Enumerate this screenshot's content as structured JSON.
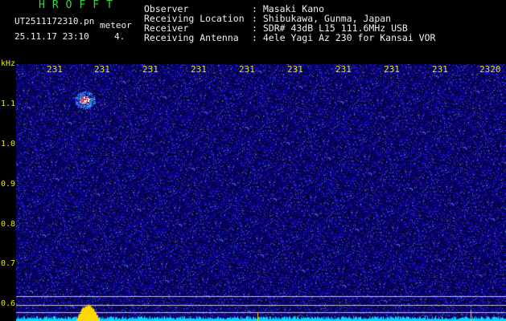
{
  "header": {
    "app_title": "HROFFT",
    "file_name": "UT2511172310.pn",
    "tag": "meteor",
    "timestamp": "25.11.17 23:10",
    "counter": "4."
  },
  "info": [
    {
      "label": "Observer",
      "value": ": Masaki Kano"
    },
    {
      "label": "Receiving Location",
      "value": ": Shibukawa, Gunma, Japan"
    },
    {
      "label": "Receiver",
      "value": ": SDR# 43dB L15 111.6MHz USB"
    },
    {
      "label": "Receiving Antenna",
      "value": ": 4ele Yagi Az 230 for Kansai VOR"
    }
  ],
  "axes": {
    "y_unit": "kHz",
    "y_ticks": [
      "1.1",
      "1.0",
      "0.9",
      "0.8",
      "0.7",
      "0.6"
    ],
    "x_ticks": [
      "231",
      "231",
      "231",
      "231",
      "231",
      "231",
      "231",
      "231",
      "231",
      "2320"
    ]
  },
  "colors": {
    "background": "#000000",
    "noise_dark": "#0a0a5a",
    "noise_mid": "#2020c0",
    "echo_hot": "#ff4040",
    "baseline": "#00d8ff",
    "signal": "#ffd800"
  }
}
